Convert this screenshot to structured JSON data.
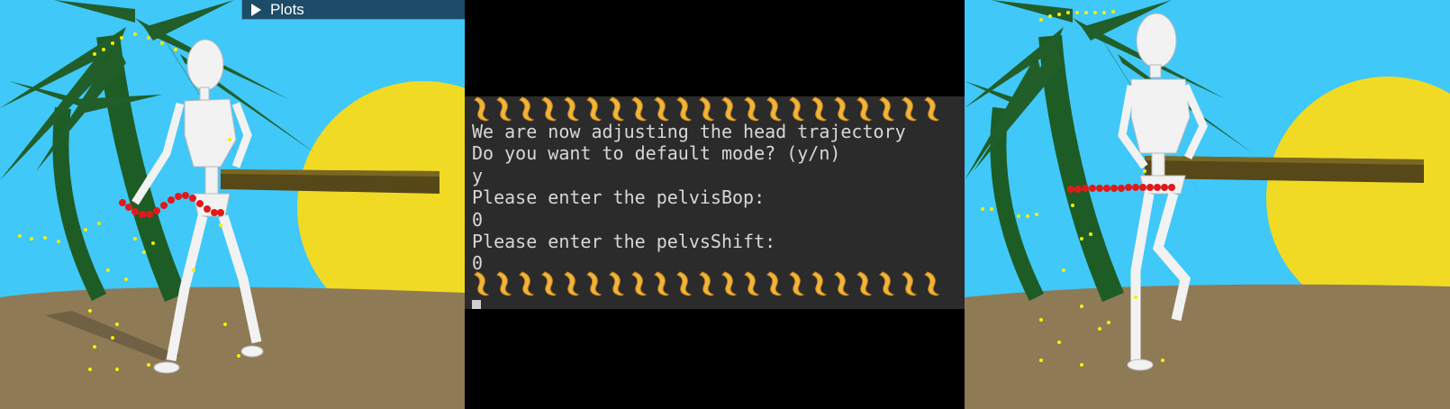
{
  "plots_panel": {
    "label": "Plots"
  },
  "terminal": {
    "lines": [
      "We are now adjusting the head trajectory",
      "Do you want to default mode? (y/n)",
      "y",
      "Please enter the pelvisBop:",
      "0",
      "Please enter the pelvsShift:",
      "0"
    ],
    "emoji_name": "leg-emoji",
    "emoji_count": 21
  },
  "colors": {
    "sky": "#40c8f8",
    "ground": "#8e7a55",
    "sun": "#f1da24",
    "palm": "#215e2a",
    "trajectory": "#e01a1a",
    "marker": "#f5f000",
    "terminal_bg": "#2b2b2b"
  }
}
